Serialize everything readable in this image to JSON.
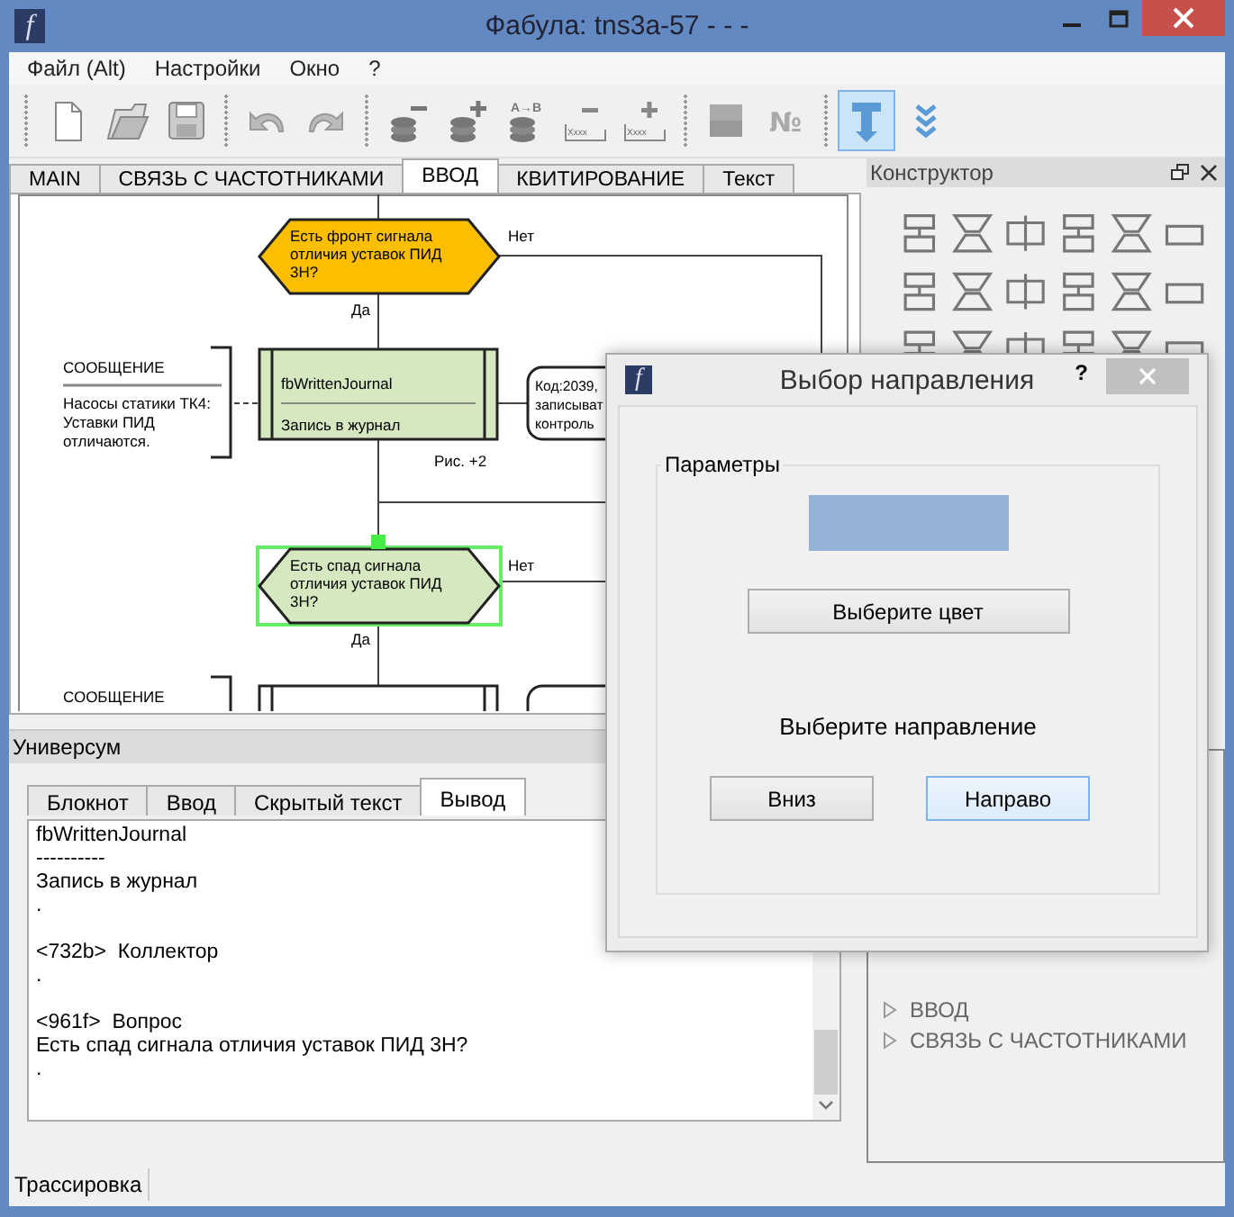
{
  "window": {
    "logo": "f",
    "title": "Фабула: tns3a-57 - - -"
  },
  "menu": [
    {
      "label": "Файл (Alt)"
    },
    {
      "label": "Настройки"
    },
    {
      "label": "Окно"
    },
    {
      "label": "?"
    }
  ],
  "toolbar": [
    {
      "kind": "new",
      "on": false
    },
    {
      "kind": "open",
      "on": false
    },
    {
      "kind": "save",
      "on": false
    },
    {
      "kind": "undo",
      "on": false
    },
    {
      "kind": "redo",
      "on": false
    },
    {
      "kind": "stack-minus",
      "on": false
    },
    {
      "kind": "stack-plus",
      "on": false
    },
    {
      "kind": "stack-swap",
      "label": "A→B",
      "on": false
    },
    {
      "kind": "field-minus",
      "label": "Xxxx",
      "on": false
    },
    {
      "kind": "field-plus",
      "label": "Xxxx",
      "on": false
    },
    {
      "kind": "fill",
      "on": false
    },
    {
      "kind": "number",
      "label": "№",
      "on": false
    },
    {
      "kind": "text-tool",
      "on": true
    },
    {
      "kind": "chevrons",
      "on": false
    }
  ],
  "tabs": [
    {
      "label": "MAIN",
      "selected": false
    },
    {
      "label": "СВЯЗЬ С ЧАСТОТНИКАМИ",
      "selected": false
    },
    {
      "label": "ВВОД",
      "selected": true
    },
    {
      "label": "КВИТИРОВАНИЕ",
      "selected": false
    },
    {
      "label": "Текст",
      "selected": false
    }
  ],
  "diagram": {
    "items": [
      {
        "kind": "decision",
        "lines": [
          "Есть фронт сигнала",
          "отличия уставок ПИД",
          "3Н?"
        ],
        "yes": "Да",
        "no": "Нет",
        "color": "#fbbf00",
        "selected": false
      },
      {
        "kind": "note",
        "title": "СООБЩЕНИЕ",
        "lines": [
          "Насосы статики ТК4:",
          "Уставки ПИД",
          "отличаются."
        ]
      },
      {
        "kind": "process",
        "name": "fbWrittenJournal",
        "caption": "Запись в журнал",
        "color": "#d5e8bf"
      },
      {
        "kind": "comment",
        "lines": [
          "Код:2039,",
          "записыват",
          "контроль"
        ]
      },
      {
        "kind": "label",
        "text": "Рис. +2"
      },
      {
        "kind": "decision",
        "lines": [
          "Есть спад сигнала",
          "отличия уставок ПИД",
          "3Н?"
        ],
        "yes": "Да",
        "no": "Нет",
        "color": "#d5e8bf",
        "selected": true
      },
      {
        "kind": "note",
        "title": "СООБЩЕНИЕ"
      }
    ]
  },
  "constructor": {
    "title": "Конструктор",
    "tree": [
      {
        "label": "ВВОД",
        "expanded": false
      },
      {
        "label": "СВЯЗЬ С ЧАСТОТНИКАМИ",
        "expanded": false
      }
    ]
  },
  "universe": {
    "title": "Универсум",
    "tabs": [
      {
        "label": "Блокнот",
        "selected": false
      },
      {
        "label": "Ввод",
        "selected": false
      },
      {
        "label": "Скрытый текст",
        "selected": false
      },
      {
        "label": "Вывод",
        "selected": true
      }
    ],
    "output": [
      {
        "lines": [
          "fbWrittenJournal",
          "----------",
          "Запись в журнал",
          "."
        ]
      },
      {
        "lines": [
          "<732b>  Коллектор",
          "."
        ]
      },
      {
        "lines": [
          "<961f>  Вопрос",
          "Есть спад сигнала отличия уставок ПИД 3Н?",
          "."
        ]
      }
    ]
  },
  "status_tab": "Трассировка",
  "dialog": {
    "logo": "f",
    "title": "Выбор направления",
    "help": "?",
    "group": "Параметры",
    "swatch": {
      "color": "#95b3d7"
    },
    "color_button": "Выберите цвет",
    "prompt": "Выберите направление",
    "buttons": [
      {
        "label": "Вниз",
        "focused": false
      },
      {
        "label": "Направо",
        "focused": true
      }
    ]
  }
}
